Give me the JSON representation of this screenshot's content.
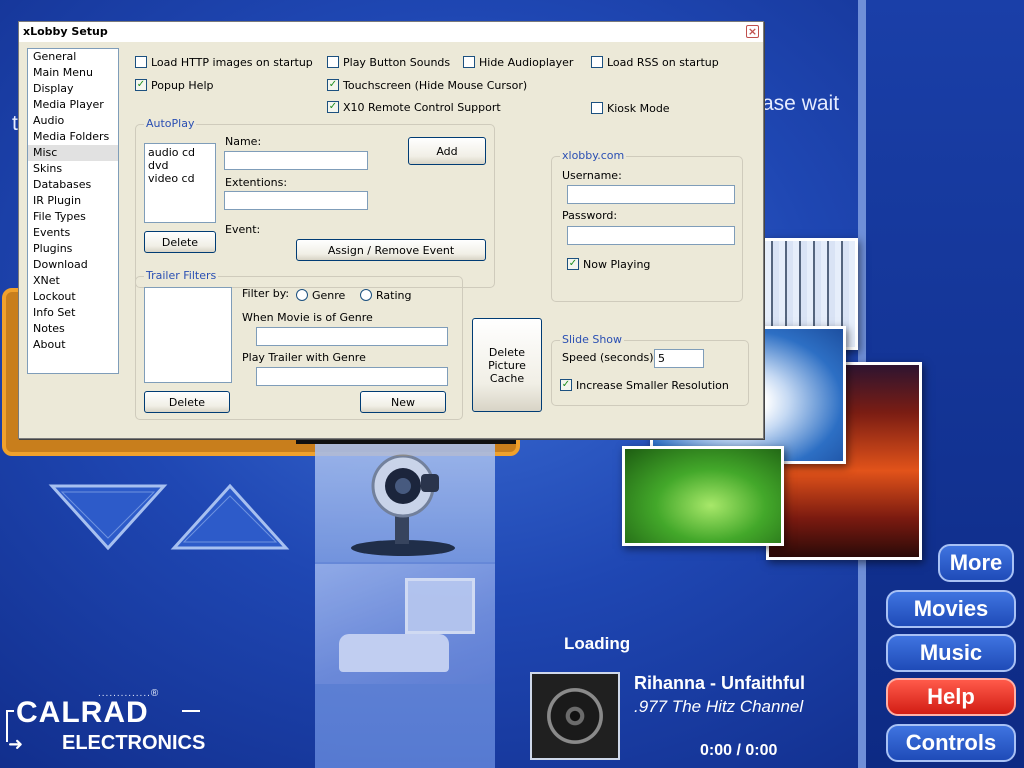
{
  "background": {
    "status_text": "ase wait",
    "status_text_left": "t",
    "nav_buttons": {
      "more": "More",
      "movies": "Movies",
      "music": "Music",
      "help": "Help",
      "controls": "Controls"
    },
    "now_playing": {
      "loading": "Loading",
      "title": "Rihanna - Unfaithful",
      "channel": ".977 The Hitz Channel",
      "time": "0:00 / 0:00"
    },
    "brand": {
      "line1": "CALRAD",
      "line2": "ELECTRONICS",
      "dots": "..............®"
    },
    "colors": {
      "help_button": "#d21d14",
      "accent_blue": "#1f47b3",
      "orange_panel": "#f0a12c"
    }
  },
  "dialog": {
    "title": "xLobby Setup",
    "close_glyph": "×",
    "sidebar": [
      "General",
      "Main Menu",
      "Display",
      "Media Player",
      "Audio",
      "Media Folders",
      "Misc",
      "Skins",
      "Databases",
      "IR Plugin",
      "File Types",
      "Events",
      "Plugins",
      "Download",
      "XNet",
      "Lockout",
      "Info Set",
      "Notes",
      "About"
    ],
    "selected_sidebar": "Misc",
    "checkboxes": {
      "load_http": {
        "label": "Load HTTP images on startup",
        "checked": false
      },
      "popup_help": {
        "label": "Popup Help",
        "checked": true
      },
      "play_button_sounds": {
        "label": "Play Button Sounds",
        "checked": false
      },
      "touchscreen": {
        "label": "Touchscreen (Hide Mouse Cursor)",
        "checked": true
      },
      "x10": {
        "label": "X10 Remote Control Support",
        "checked": true
      },
      "hide_audioplayer": {
        "label": "Hide Audioplayer",
        "checked": false
      },
      "load_rss": {
        "label": "Load RSS on startup",
        "checked": false
      },
      "kiosk_mode": {
        "label": "Kiosk Mode",
        "checked": false
      }
    },
    "autoplay": {
      "group_title": "AutoPlay",
      "items": [
        "audio cd",
        "dvd",
        "video cd"
      ],
      "name_label": "Name:",
      "name_value": "",
      "extentions_label": "Extentions:",
      "extentions_value": "",
      "event_label": "Event:",
      "add_button": "Add",
      "delete_button": "Delete",
      "assign_button": "Assign / Remove Event"
    },
    "xlobby_com": {
      "group_title": "xlobby.com",
      "username_label": "Username:",
      "username_value": "",
      "password_label": "Password:",
      "password_value": "",
      "now_playing": {
        "label": "Now Playing",
        "checked": true
      }
    },
    "trailer_filters": {
      "group_title": "Trailer Filters",
      "filter_by_label": "Filter by:",
      "radio_genre": "Genre",
      "radio_rating": "Rating",
      "when_movie_label": "When Movie is of Genre",
      "when_movie_value": "",
      "play_trailer_label": "Play Trailer with Genre",
      "play_trailer_value": "",
      "delete_button": "Delete",
      "new_button": "New"
    },
    "delete_picture_cache": {
      "line1": "Delete",
      "line2": "Picture",
      "line3": "Cache"
    },
    "slide_show": {
      "group_title": "Slide Show",
      "speed_label": "Speed (seconds):",
      "speed_value": "5",
      "increase_smaller": {
        "label": "Increase Smaller Resolution",
        "checked": true
      }
    }
  }
}
